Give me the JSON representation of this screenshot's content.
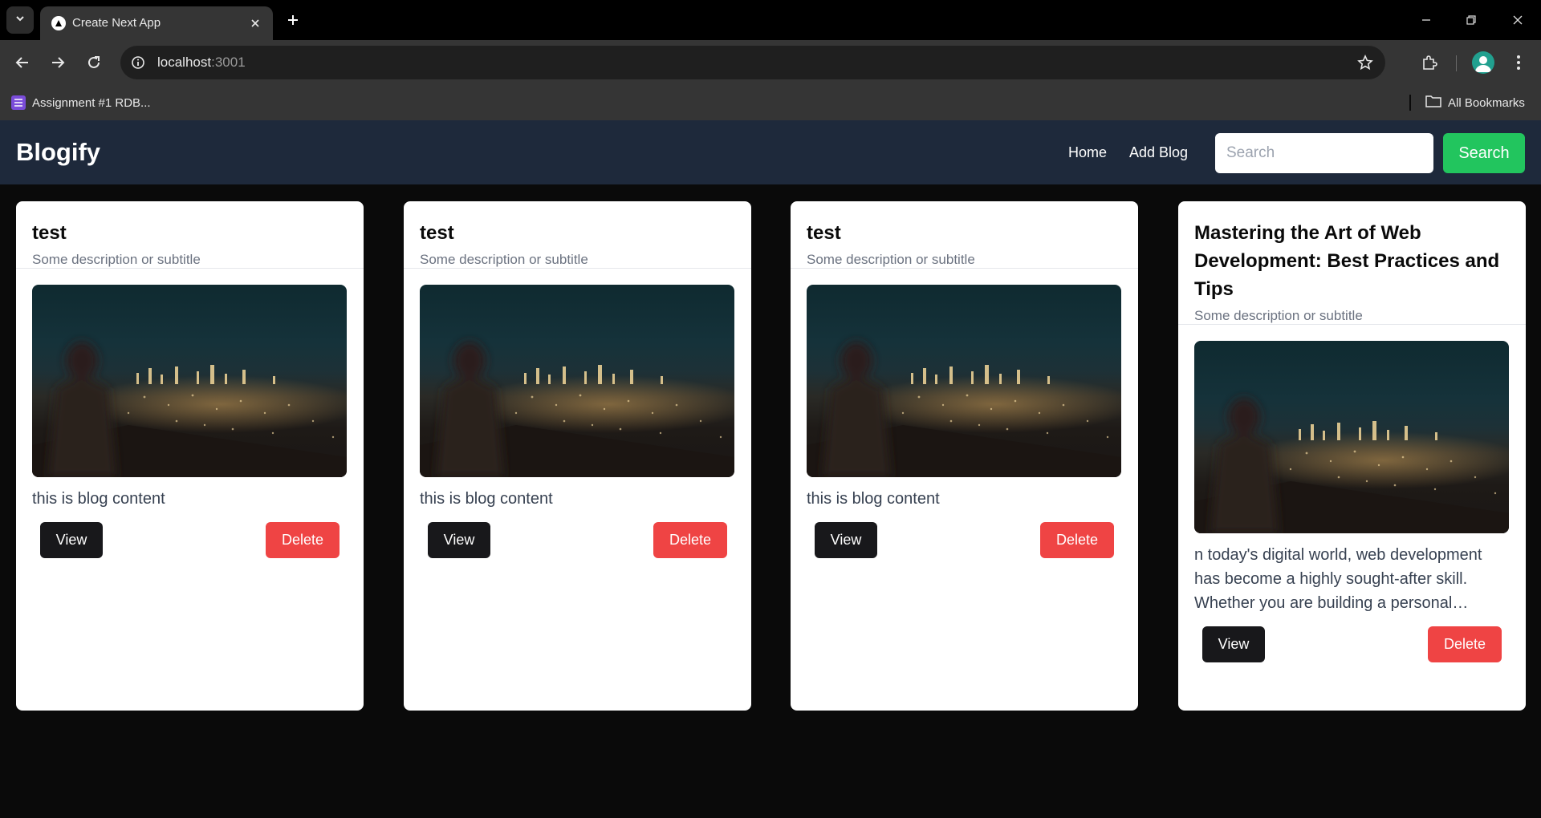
{
  "browser": {
    "tab_title": "Create Next App",
    "url_host": "localhost",
    "url_port": ":3001",
    "bookmarks": [
      {
        "label": "Assignment #1 RDB..."
      }
    ],
    "all_bookmarks_label": "All Bookmarks"
  },
  "app": {
    "brand": "Blogify",
    "nav": [
      {
        "label": "Home"
      },
      {
        "label": "Add Blog"
      }
    ],
    "search": {
      "placeholder": "Search",
      "value": "",
      "button_label": "Search"
    }
  },
  "colors": {
    "navbar": "#1e293b",
    "search_button": "#22c55e",
    "view_button": "#18181b",
    "delete_button": "#ef4444"
  },
  "cards": [
    {
      "title": "test",
      "subtitle": "Some description or subtitle",
      "content": "this is blog content",
      "view_label": "View",
      "delete_label": "Delete"
    },
    {
      "title": "test",
      "subtitle": "Some description or subtitle",
      "content": "this is blog content",
      "view_label": "View",
      "delete_label": "Delete"
    },
    {
      "title": "test",
      "subtitle": "Some description or subtitle",
      "content": "this is blog content",
      "view_label": "View",
      "delete_label": "Delete"
    },
    {
      "title": "Mastering the Art of Web Development: Best Practices and Tips",
      "subtitle": "Some description or subtitle",
      "content": "n today's digital world, web development has become a highly sought-after skill. Whether you are building a personal website, a blog or a web application",
      "view_label": "View",
      "delete_label": "Delete"
    }
  ]
}
